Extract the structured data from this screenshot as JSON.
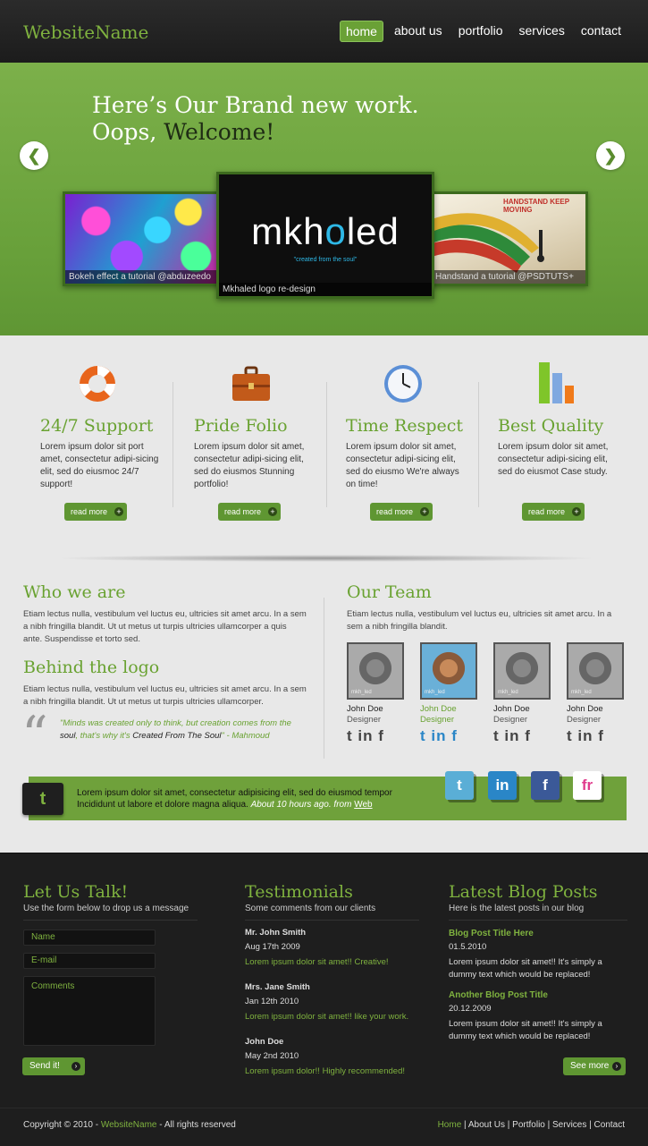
{
  "header": {
    "logo": "WebsiteName",
    "nav": [
      "home",
      "about us",
      "portfolio",
      "services",
      "contact"
    ]
  },
  "hero": {
    "title_line1": "Here’s Our Brand new work.",
    "title_line2_a": "Oops, ",
    "title_line2_b": "Welcome!",
    "slides": [
      {
        "caption": "Bokeh effect a tutorial @abduzeedo"
      },
      {
        "brand_a": "mkh",
        "brand_o": "o",
        "brand_b": "led",
        "tagline": "\"created from the soul\"",
        "caption": "Mkhaled logo re-design"
      },
      {
        "title": "HANDSTAND KEEP MOVING",
        "caption": "Handstand a tutorial @PSDTUTS+"
      }
    ]
  },
  "features": [
    {
      "title": "24/7 Support",
      "text": "Lorem ipsum dolor sit port amet, consectetur adipi-sicing elit, sed do eiusmoc 24/7 support!",
      "button": "read more",
      "icon": "lifebuoy-icon"
    },
    {
      "title": "Pride Folio",
      "text": "Lorem ipsum dolor sit amet, consectetur adipi-sicing elit, sed do eiusmos Stunning portfolio!",
      "button": "read more",
      "icon": "briefcase-icon"
    },
    {
      "title": "Time Respect",
      "text": "Lorem ipsum dolor sit amet, consectetur adipi-sicing elit, sed do eiusmo We're always on time!",
      "button": "read more",
      "icon": "clock-icon"
    },
    {
      "title": "Best Quality",
      "text": "Lorem ipsum dolor sit amet, consectetur adipi-sicing elit, sed do eiusmot Case study.",
      "button": "read more",
      "icon": "bar-chart-icon"
    }
  ],
  "about": {
    "who_title": "Who we are",
    "who_text": "Etiam lectus nulla, vestibulum vel luctus eu, ultricies sit amet arcu. In a sem a nibh fringilla blandit. Ut ut metus ut turpis ultricies ullamcorper a quis ante. Suspendisse et torto sed.",
    "logo_title": "Behind the logo",
    "logo_text": "Etiam lectus nulla, vestibulum vel luctus eu, ultricies sit amet arcu. In a sem a nibh fringilla blandit. Ut ut metus ut turpis ultricies ullamcorper.",
    "quote_mark": "“",
    "quote_a": "\"Minds was created only to think, but creation comes from the ",
    "quote_b": "soul",
    "quote_c": ", that's why it's ",
    "quote_d": "Created From The Soul",
    "quote_e": "\" - Mahmoud"
  },
  "team": {
    "title": "Our Team",
    "text": "Etiam lectus nulla, vestibulum vel luctus eu, ultricies sit amet arcu. In a sem a nibh fringilla blandit.",
    "members": [
      {
        "name": "John Doe",
        "role": "Designer",
        "photo_tag": "mkh_led",
        "social": "t in f"
      },
      {
        "name": "John Doe",
        "role": "Designer",
        "photo_tag": "mkh_led",
        "social": "t in f"
      },
      {
        "name": "John Doe",
        "role": "Designer",
        "photo_tag": "mkh_led",
        "social": "t in f"
      },
      {
        "name": "John Doe",
        "role": "Designer",
        "photo_tag": "mkh_led",
        "social": "t in f"
      }
    ]
  },
  "tweet": {
    "icon": "t",
    "text": "Lorem ipsum dolor sit amet, consectetur adipisicing elit, sed do eiusmod tempor Incididunt ut labore et dolore magna aliqua. ",
    "meta": "About 10 hours ago. from ",
    "link": "Web"
  },
  "social_boxes": [
    {
      "label": "t",
      "icon": "twitter-icon",
      "bg": "#5aaed6",
      "fg": "#ffffff"
    },
    {
      "label": "in",
      "icon": "linkedin-icon",
      "bg": "#2a86c7",
      "fg": "#ffffff"
    },
    {
      "label": "f",
      "icon": "facebook-icon",
      "bg": "#3b5998",
      "fg": "#ffffff"
    },
    {
      "label": "fr",
      "icon": "friendfeed-icon",
      "bg": "#ffffff",
      "fg": "#e03a8c"
    }
  ],
  "footer": {
    "contact_title": "Let Us Talk!",
    "contact_sub": "Use the form below to drop us a message",
    "name_ph": "Name",
    "email_ph": "E-mail",
    "comments_ph": "Comments",
    "send": "Send it!",
    "testi_title": "Testimonials",
    "testi_sub": "Some comments from our clients",
    "testimonials": [
      {
        "name": "Mr.  John Smith",
        "date": "Aug 17th 2009",
        "text": "Lorem ipsum dolor sit amet!! Creative!"
      },
      {
        "name": "Mrs.  Jane Smith",
        "date": "Jan 12th 2010",
        "text": "Lorem ipsum dolor sit amet!! like your work."
      },
      {
        "name": "John Doe",
        "date": "May 2nd 2010",
        "text": "Lorem ipsum dolor!! Highly recommended!"
      }
    ],
    "blog_title": "Latest Blog Posts",
    "blog_sub": "Here is the latest posts in our blog",
    "posts": [
      {
        "title": "Blog Post Title Here",
        "date": "01.5.2010",
        "text": "Lorem ipsum dolor sit amet!! It's simply a dummy text which would be replaced!"
      },
      {
        "title": "Another Blog Post Title",
        "date": "20.12.2009",
        "text": "Lorem ipsum dolor sit amet!! It's simply a dummy text which would be replaced!"
      }
    ],
    "see_more": "See more",
    "copy_a": "Copyright © 2010 - ",
    "copy_b": "WebsiteName",
    "copy_c": " - All rights reserved",
    "nav": [
      "Home",
      "About Us",
      "Portfolio",
      "Services",
      "Contact"
    ]
  },
  "colors": {
    "accent": "#69a231",
    "hero_bg": "#6aa13b",
    "dark": "#1e1e1e"
  }
}
